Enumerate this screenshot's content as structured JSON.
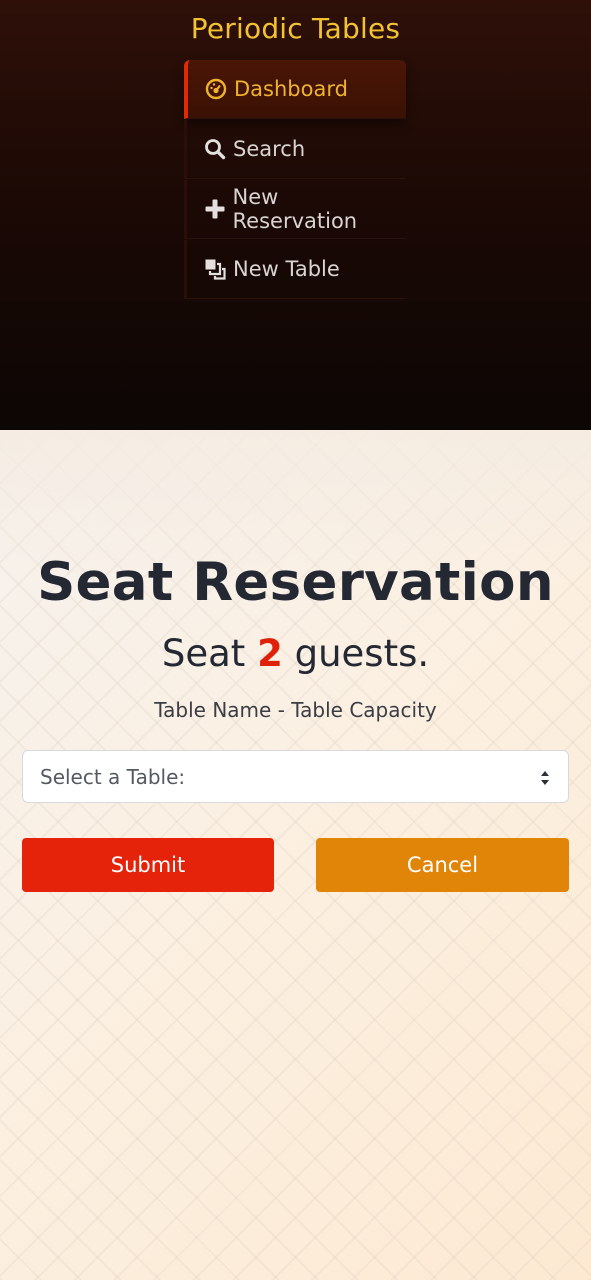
{
  "nav": {
    "brand": "Periodic Tables",
    "items": [
      {
        "label": "Dashboard",
        "icon": "dashboard-icon",
        "active": true
      },
      {
        "label": "Search",
        "icon": "search-icon",
        "active": false
      },
      {
        "label": "New Reservation",
        "icon": "plus-icon",
        "active": false
      },
      {
        "label": "New Table",
        "icon": "layers-icon",
        "active": false
      }
    ]
  },
  "main": {
    "title": "Seat Reservation",
    "guest_prefix": "Seat",
    "guest_count": "2",
    "guest_suffix": "guests.",
    "hint": "Table Name - Table Capacity",
    "select": {
      "selected": "Select a Table:"
    },
    "submit_label": "Submit",
    "cancel_label": "Cancel"
  },
  "colors": {
    "brand": "#f3c230",
    "active_text": "#f0b22d",
    "active_border": "#e02a06",
    "submit": "#e5230a",
    "cancel": "#e08507",
    "accent_count": "#e0210a"
  }
}
